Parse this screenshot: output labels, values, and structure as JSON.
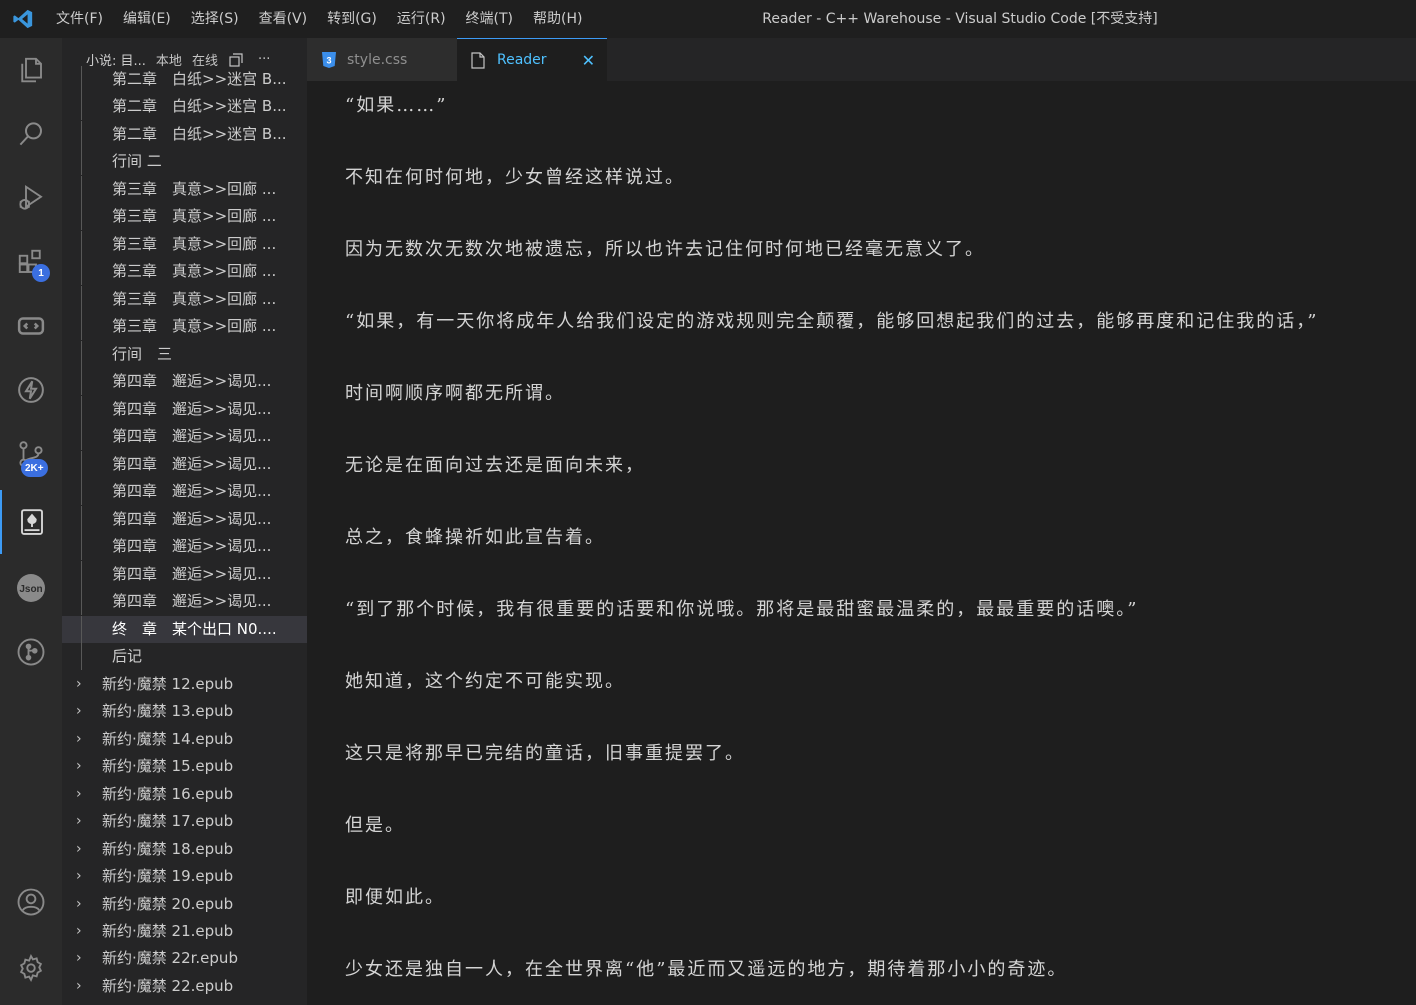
{
  "titlebar": {
    "menu": [
      "文件(F)",
      "编辑(E)",
      "选择(S)",
      "查看(V)",
      "转到(G)",
      "运行(R)",
      "终端(T)",
      "帮助(H)"
    ],
    "window_title": "Reader - C++ Warehouse - Visual Studio Code [不受支持]"
  },
  "activitybar": {
    "extensions_badge": "1",
    "source_control_badge": "2K+",
    "accent_color": "#3d9bf5"
  },
  "sidebar": {
    "title": "小说: 目...",
    "tabs": [
      "本地",
      "在线"
    ],
    "more": "···",
    "items": [
      "第二章　白纸>>迷宫 B...",
      "第二章　白纸>>迷宫 B...",
      "第二章　白纸>>迷宫 B...",
      "行间 二",
      "第三章　真意>>回廊 ...",
      "第三章　真意>>回廊 ...",
      "第三章　真意>>回廊 ...",
      "第三章　真意>>回廊 ...",
      "第三章　真意>>回廊 ...",
      "第三章　真意>>回廊 ...",
      "行间　三",
      "第四章　邂逅>>谒见...",
      "第四章　邂逅>>谒见...",
      "第四章　邂逅>>谒见...",
      "第四章　邂逅>>谒见...",
      "第四章　邂逅>>谒见...",
      "第四章　邂逅>>谒见...",
      "第四章　邂逅>>谒见...",
      "第四章　邂逅>>谒见...",
      "第四章　邂逅>>谒见...",
      "终　章　某个出口 N0....",
      "后记"
    ],
    "selected_item": "终　章　某个出口 N0....",
    "folders": [
      "新约·魔禁 12.epub",
      "新约·魔禁 13.epub",
      "新约·魔禁 14.epub",
      "新约·魔禁 15.epub",
      "新约·魔禁 16.epub",
      "新约·魔禁 17.epub",
      "新约·魔禁 18.epub",
      "新约·魔禁 19.epub",
      "新约·魔禁 20.epub",
      "新约·魔禁 21.epub",
      "新约·魔禁 22r.epub",
      "新约·魔禁 22.epub"
    ]
  },
  "tabs": [
    {
      "label": "style.css",
      "icon": "css-icon"
    },
    {
      "label": "Reader",
      "icon": "file-icon",
      "close": "✕"
    }
  ],
  "editor": {
    "lines": [
      "“如果……”",
      "不知在何时何地，少女曾经这样说过。",
      "因为无数次无数次地被遗忘，所以也许去记住何时何地已经毫无意义了。",
      "“如果，有一天你将成年人给我们设定的游戏规则完全颠覆，能够回想起我们的过去，能够再度和记住我的话，”",
      "时间啊顺序啊都无所谓。",
      "无论是在面向过去还是面向未来，",
      "总之，食蜂操祈如此宣告着。",
      "“到了那个时候，我有很重要的话要和你说哦。那将是最甜蜜最温柔的，最最重要的话噢。”",
      "她知道，这个约定不可能实现。",
      "这只是将那早已完结的童话，旧事重提罢了。",
      "但是。",
      "即便如此。",
      "少女还是独自一人，在全世界离“他”最近而又遥远的地方，期待着那小小的奇迹。"
    ]
  }
}
